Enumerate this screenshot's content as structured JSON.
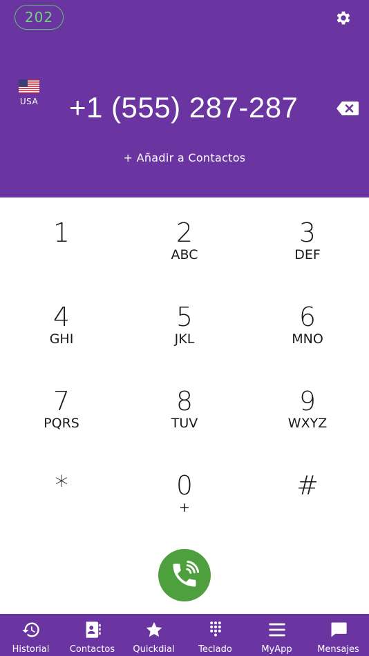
{
  "header": {
    "credit": "202",
    "country_code": "USA",
    "phone_number": "+1 (555) 287-287",
    "add_contact": "+ Añadir a Contactos",
    "background": "#6a35a0"
  },
  "keypad": [
    {
      "digit": "1",
      "letters": ""
    },
    {
      "digit": "2",
      "letters": "ABC"
    },
    {
      "digit": "3",
      "letters": "DEF"
    },
    {
      "digit": "4",
      "letters": "GHI"
    },
    {
      "digit": "5",
      "letters": "JKL"
    },
    {
      "digit": "6",
      "letters": "MNO"
    },
    {
      "digit": "7",
      "letters": "PQRS"
    },
    {
      "digit": "8",
      "letters": "TUV"
    },
    {
      "digit": "9",
      "letters": "WXYZ"
    },
    {
      "digit": "*",
      "letters": ""
    },
    {
      "digit": "0",
      "letters": "+"
    },
    {
      "digit": "#",
      "letters": ""
    }
  ],
  "call_button": {
    "icon": "phone-call-icon",
    "color": "#4e9f3d"
  },
  "tabs": [
    {
      "label": "Historial",
      "icon": "history-icon"
    },
    {
      "label": "Contactos",
      "icon": "contacts-icon"
    },
    {
      "label": "Quickdial",
      "icon": "star-icon"
    },
    {
      "label": "Teclado",
      "icon": "keypad-icon"
    },
    {
      "label": "MyApp",
      "icon": "menu-icon"
    },
    {
      "label": "Mensajes",
      "icon": "message-icon"
    }
  ]
}
